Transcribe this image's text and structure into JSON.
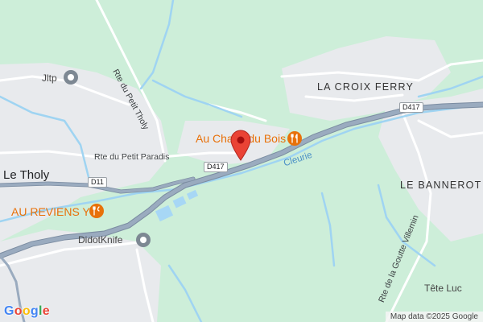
{
  "map": {
    "places": {
      "la_croix_ferry": "LA CROIX FERRY",
      "le_bannerot": "LE BANNEROT",
      "le_tholy": "Le Tholy",
      "tete_luc": "Tête Luc"
    },
    "roads": {
      "rte_petit_tholy": "Rte du Petit Tholy",
      "rte_petit_paradis": "Rte du Petit Paradis",
      "rte_goutte_villemin": "Rte de la Goutte Villemin"
    },
    "road_shields": {
      "d417_east": "D417",
      "d417_center": "D417",
      "d11": "D11"
    },
    "waterways": {
      "cleurie": "Cleurie"
    },
    "pois": {
      "jltp": "Jltp",
      "didotknife": "DidotKnife",
      "restaurant_1": "Au Chalet du Bois",
      "restaurant_2": "AU REVIENS Y"
    },
    "marker": {
      "label": "location-pin",
      "color": "#ea4335"
    },
    "brand": {
      "G": "G",
      "o1": "o",
      "o2": "o",
      "g": "g",
      "l": "l",
      "e": "e"
    },
    "attribution": "Map data ©2025 Google",
    "colors": {
      "forest": "#cdeed9",
      "built_area": "#e8eaed",
      "highway": "#8a9bb0",
      "river": "#9fd4f2",
      "food_poi": "#e8710a"
    }
  }
}
